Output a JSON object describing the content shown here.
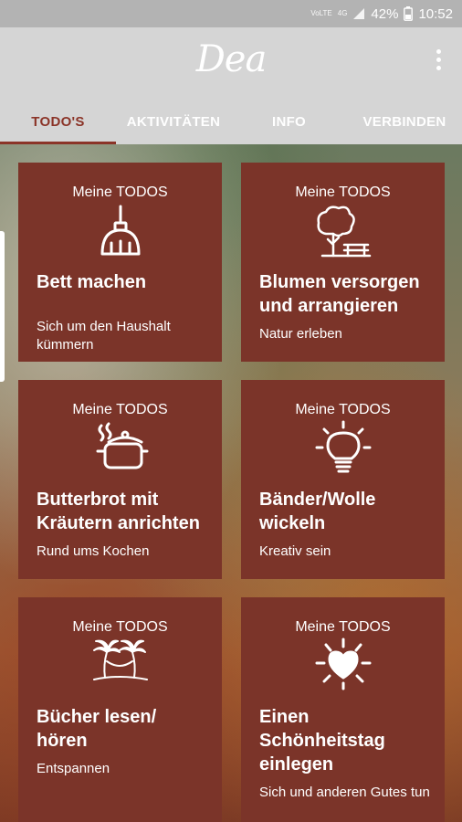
{
  "status_bar": {
    "network_label_1": "VoLTE",
    "network_label_2": "4G",
    "battery": "42%",
    "time": "10:52"
  },
  "app_bar": {
    "logo": "Dea",
    "tabs": [
      {
        "label": "TODO'S",
        "active": true
      },
      {
        "label": "AKTIVITÄTEN",
        "active": false
      },
      {
        "label": "INFO",
        "active": false
      },
      {
        "label": "VERBINDEN",
        "active": false
      }
    ]
  },
  "cards": [
    {
      "kicker": "Meine TODOS",
      "icon": "broom-icon",
      "title": "Bett machen",
      "subtitle": "Sich um den Haushalt kümmern"
    },
    {
      "kicker": "Meine TODOS",
      "icon": "tree-bench-icon",
      "title": "Blumen versorgen und arrangieren",
      "subtitle": "Natur erleben"
    },
    {
      "kicker": "Meine TODOS",
      "icon": "cooking-pot-icon",
      "title": "Butterbrot mit Kräutern anrichten",
      "subtitle": "Rund ums Kochen"
    },
    {
      "kicker": "Meine TODOS",
      "icon": "lightbulb-icon",
      "title": "Bänder/Wolle wickeln",
      "subtitle": "Kreativ sein"
    },
    {
      "kicker": "Meine TODOS",
      "icon": "palm-hammock-icon",
      "title": "Bücher lesen/ hören",
      "subtitle": "Entspannen"
    },
    {
      "kicker": "Meine TODOS",
      "icon": "heart-rays-icon",
      "title": "Einen Schönheitstag einlegen",
      "subtitle": "Sich und anderen Gutes tun"
    }
  ],
  "colors": {
    "card": "#7b3429",
    "accent": "#8b3428",
    "app_bar": "#d5d5d5"
  }
}
